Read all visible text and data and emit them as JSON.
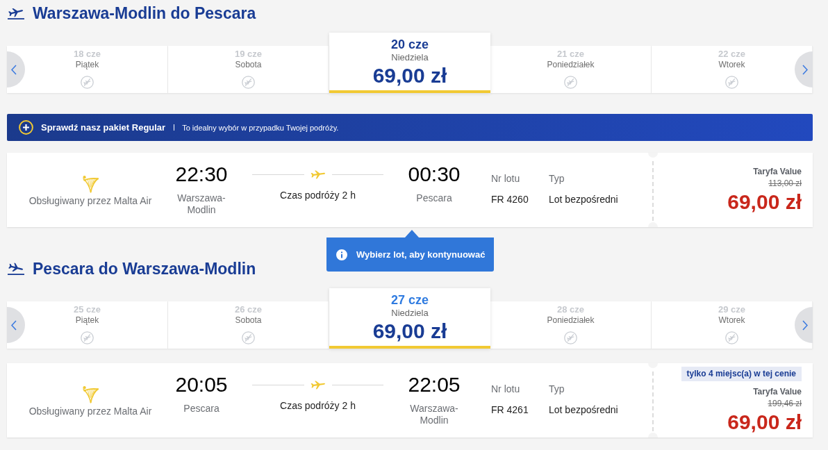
{
  "sections": [
    {
      "kind": "outbound",
      "title": "Warszawa-Modlin do Pescara",
      "days": [
        {
          "date": "18 cze",
          "weekday": "Piątek",
          "selected": false,
          "focused": false
        },
        {
          "date": "19 cze",
          "weekday": "Sobota",
          "selected": false,
          "focused": false
        },
        {
          "date": "20 cze",
          "weekday": "Niedziela",
          "price": "69,00 zł",
          "selected": true,
          "focused": false
        },
        {
          "date": "21 cze",
          "weekday": "Poniedziałek",
          "selected": false,
          "focused": false
        },
        {
          "date": "22 cze",
          "weekday": "Wtorek",
          "selected": false,
          "focused": false
        }
      ],
      "promo": {
        "title": "Sprawdź nasz pakiet Regular",
        "text": "To idealny wybór w przypadku Twojej podróży."
      },
      "flight": {
        "operator": "Obsługiwany przez Malta Air",
        "departure_time": "22:30",
        "departure_city": "Warszawa-Modlin",
        "duration": "Czas podróży 2 h",
        "arrival_time": "00:30",
        "arrival_city": "Pescara",
        "flight_number_label": "Nr lotu",
        "flight_number": "FR 4260",
        "type_label": "Typ",
        "type": "Lot bezpośredni",
        "fare_name": "Taryfa Value",
        "old_price": "113,00 zł",
        "price": "69,00 zł"
      },
      "tooltip": {
        "text": "Wybierz lot, aby kontynuować"
      }
    },
    {
      "kind": "return",
      "title": "Pescara do Warszawa-Modlin",
      "days": [
        {
          "date": "25 cze",
          "weekday": "Piątek",
          "selected": false,
          "focused": false
        },
        {
          "date": "26 cze",
          "weekday": "Sobota",
          "selected": false,
          "focused": false
        },
        {
          "date": "27 cze",
          "weekday": "Niedziela",
          "price": "69,00 zł",
          "selected": true,
          "focused": true
        },
        {
          "date": "28 cze",
          "weekday": "Poniedziałek",
          "selected": false,
          "focused": false
        },
        {
          "date": "29 cze",
          "weekday": "Wtorek",
          "selected": false,
          "focused": false
        }
      ],
      "flight": {
        "operator": "Obsługiwany przez Malta Air",
        "departure_time": "20:05",
        "departure_city": "Pescara",
        "duration": "Czas podróży 2 h",
        "arrival_time": "22:05",
        "arrival_city": "Warszawa-Modlin",
        "flight_number_label": "Nr lotu",
        "flight_number": "FR 4261",
        "type_label": "Typ",
        "type": "Lot bezpośredni",
        "badge": "tylko 4 miejsc(a) w tej cenie",
        "fare_name": "Taryfa Value",
        "old_price": "199,46 zł",
        "price": "69,00 zł"
      }
    }
  ]
}
